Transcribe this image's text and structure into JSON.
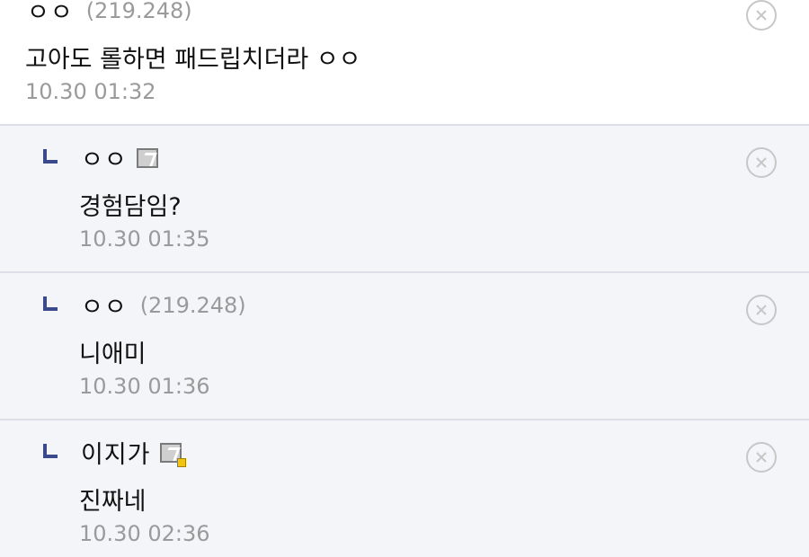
{
  "comments": [
    {
      "nickname": "ㅇㅇ",
      "ip": "(219.248)",
      "text": "고아도 롤하면 패드립치더라 ㅇㅇ",
      "date": "10.30 01:32"
    },
    {
      "nickname": "ㅇㅇ",
      "badge": "gallog-icon",
      "text": "경험담임?",
      "date": "10.30 01:35"
    },
    {
      "nickname": "ㅇㅇ",
      "ip": "(219.248)",
      "text": "니애미",
      "date": "10.30 01:36"
    },
    {
      "nickname": "이지가",
      "badge": "gallog-fixed-icon",
      "text": "진짜네",
      "date": "10.30 02:36"
    }
  ],
  "icons": {
    "reply": "reply-arrow-icon",
    "delete": "delete-circle-icon"
  },
  "colors": {
    "reply_background": "#f4f5f9",
    "reply_arrow": "#3b4a8c",
    "meta_text": "#9a9a9a",
    "divider": "#dcdfe8"
  }
}
